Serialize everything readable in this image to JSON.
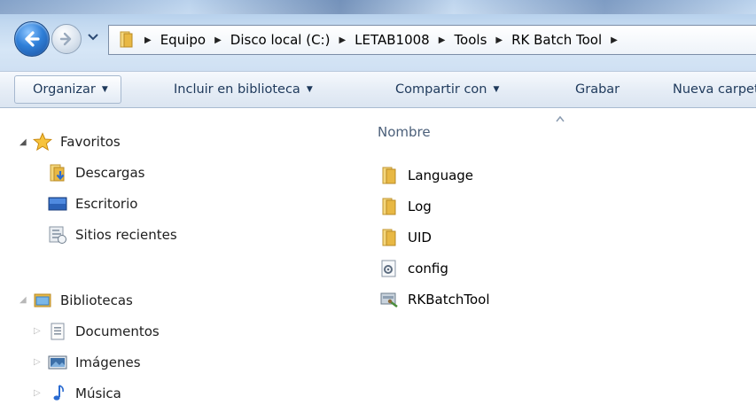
{
  "breadcrumbs": [
    "Equipo",
    "Disco local (C:)",
    "LETAB1008",
    "Tools",
    "RK Batch Tool"
  ],
  "toolbar": {
    "organize": "Organizar",
    "include_library": "Incluir en biblioteca",
    "share": "Compartir con",
    "burn": "Grabar",
    "new_folder": "Nueva carpeta"
  },
  "nav": {
    "favorites": {
      "label": "Favoritos",
      "items": [
        {
          "label": "Descargas",
          "icon": "downloads-folder-icon"
        },
        {
          "label": "Escritorio",
          "icon": "desktop-icon"
        },
        {
          "label": "Sitios recientes",
          "icon": "recent-places-icon"
        }
      ]
    },
    "libraries": {
      "label": "Bibliotecas",
      "items": [
        {
          "label": "Documentos",
          "icon": "documents-icon"
        },
        {
          "label": "Imágenes",
          "icon": "pictures-icon"
        },
        {
          "label": "Música",
          "icon": "music-icon"
        }
      ]
    }
  },
  "content": {
    "column_name": "Nombre",
    "files": [
      {
        "name": "Language",
        "type": "folder"
      },
      {
        "name": "Log",
        "type": "folder"
      },
      {
        "name": "UID",
        "type": "folder"
      },
      {
        "name": "config",
        "type": "settings"
      },
      {
        "name": "RKBatchTool",
        "type": "application"
      }
    ]
  },
  "colors": {
    "folder": "#e8b844",
    "command_text": "#1e395b",
    "header_text": "#4c607a",
    "back_button": "#2f7fd8"
  }
}
